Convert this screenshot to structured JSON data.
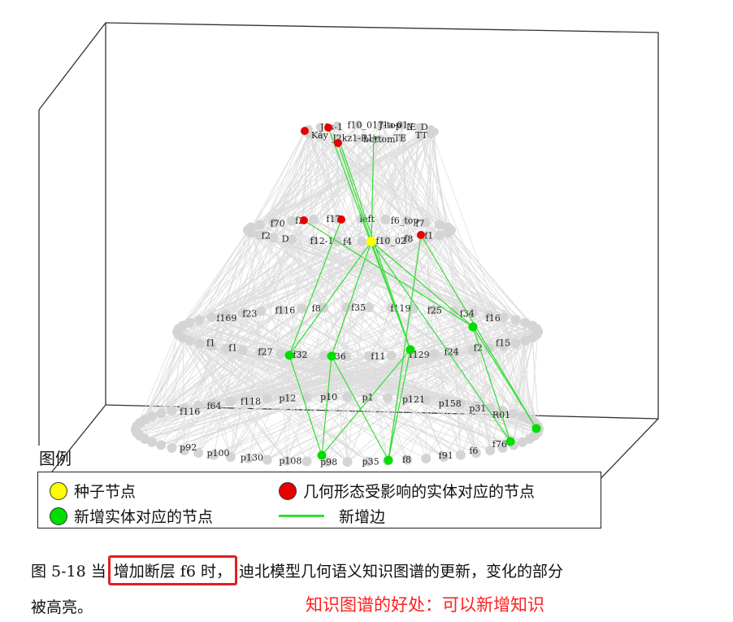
{
  "colors": {
    "seed": "#ffff00",
    "affected": "#e60000",
    "new_node": "#00dd00",
    "new_edge": "#33dd33",
    "default_node": "#d4d4d4",
    "default_edge": "#dddddd",
    "annotation": "#ff2020",
    "box_border": "#e02020"
  },
  "graph": {
    "top_labels": [
      "TT",
      "J1s-1",
      "TE",
      "f10_017-top",
      "bottom",
      "J1a-01y",
      "J2kz1-R1y",
      "IE_D",
      "Kay"
    ],
    "level2_labels": [
      "f1",
      "f70",
      "f8",
      "f2",
      "f10_02",
      "f17",
      "f4",
      "left",
      "f12-1",
      "f6_top",
      "D",
      "f7",
      "f2"
    ],
    "level3_labels": [
      "f15",
      "f169",
      "f2",
      "f23",
      "f24",
      "f116",
      "f129",
      "f8",
      "f11",
      "f35",
      "f36",
      "f119",
      "f32",
      "f25",
      "f27",
      "f34",
      "f1",
      "f16",
      "f1"
    ],
    "level4_labels": [
      "f76",
      "f116",
      "f6",
      "f64",
      "f91",
      "f118",
      "f8",
      "p12",
      "p35",
      "p10",
      "p98",
      "p1",
      "p108",
      "p121",
      "p130",
      "p158",
      "p100",
      "p31",
      "p92",
      "R01"
    ]
  },
  "legend": {
    "title": "图例",
    "seed_label": "种子节点",
    "affected_label": "几何形态受影响的实体对应的节点",
    "new_node_label": "新增实体对应的节点",
    "new_edge_label": "新增边"
  },
  "caption": {
    "prefix": "图 5-18 当",
    "highlight": "增加断层 f6 时，",
    "rest": "迪北模型几何语义知识图谱的更新，变化的部分",
    "line2": "被高亮。"
  },
  "annotation": "知识图谱的好处：可以新增知识"
}
